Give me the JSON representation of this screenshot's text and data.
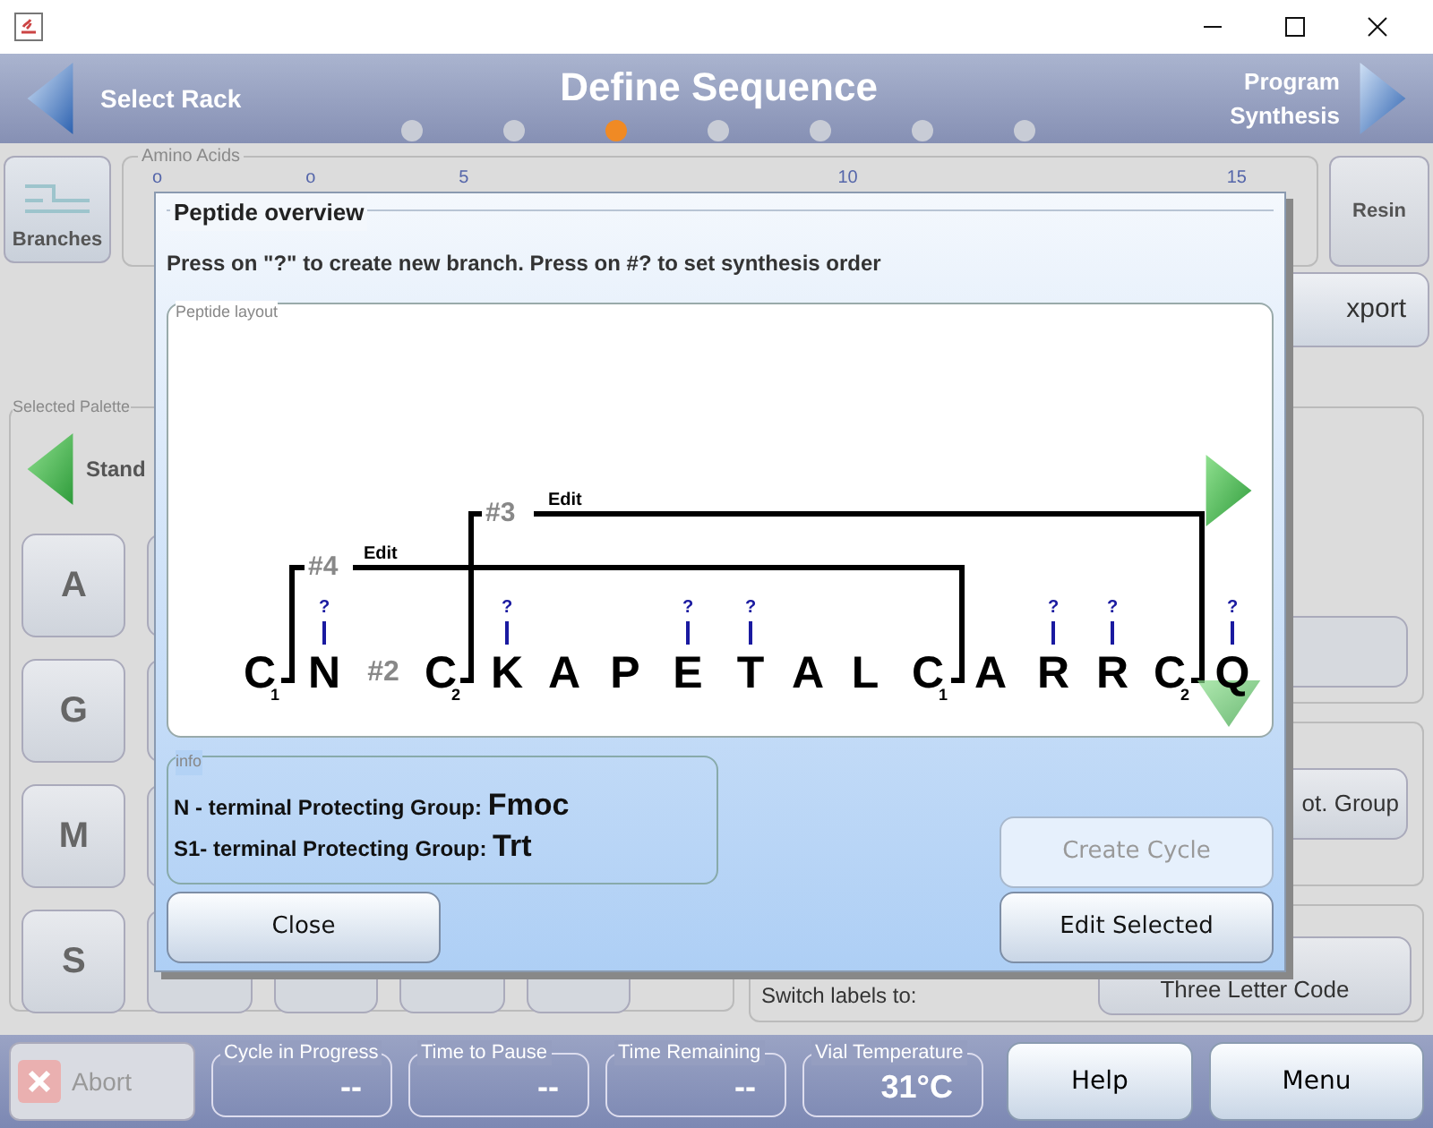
{
  "header": {
    "back_label": "Select Rack",
    "title": "Define Sequence",
    "next_label": "Program Synthesis",
    "steps": [
      {
        "selected": false
      },
      {
        "selected": false
      },
      {
        "selected": true
      },
      {
        "selected": false
      },
      {
        "selected": false
      },
      {
        "selected": false
      },
      {
        "selected": false
      }
    ]
  },
  "sequence_bar": {
    "branches_button": "Branches",
    "legend": "Amino Acids",
    "ticks": [
      "o",
      "o",
      "5",
      "10",
      "15"
    ],
    "resin_button": "Resin"
  },
  "export_button": "xport",
  "palette": {
    "legend": "Selected Palette",
    "name": "Stand",
    "keys": [
      "A",
      "G",
      "M",
      "S"
    ]
  },
  "options": {
    "group_button": "ot. Group",
    "switch_label": "Switch labels to:",
    "label_mode_button": "Three Letter Code"
  },
  "dialog": {
    "title": "Peptide overview",
    "instruction": "Press on \"?\" to create new branch. Press on #? to set synthesis order",
    "layout": {
      "legend": "Peptide layout",
      "residues": [
        {
          "kind": "residue",
          "text": "C",
          "sub": "1"
        },
        {
          "kind": "residue",
          "text": "N",
          "marker": "?"
        },
        {
          "kind": "order",
          "text": "#2"
        },
        {
          "kind": "residue",
          "text": "C",
          "sub": "2"
        },
        {
          "kind": "residue",
          "text": "K",
          "marker": "?"
        },
        {
          "kind": "residue",
          "text": "A"
        },
        {
          "kind": "residue",
          "text": "P"
        },
        {
          "kind": "residue",
          "text": "E",
          "marker": "?"
        },
        {
          "kind": "residue",
          "text": "T",
          "marker": "?"
        },
        {
          "kind": "residue",
          "text": "A"
        },
        {
          "kind": "residue",
          "text": "L"
        },
        {
          "kind": "residue",
          "text": "C",
          "sub": "1"
        },
        {
          "kind": "residue",
          "text": "A"
        },
        {
          "kind": "residue",
          "text": "R",
          "marker": "?"
        },
        {
          "kind": "residue",
          "text": "R",
          "marker": "?"
        },
        {
          "kind": "residue",
          "text": "C",
          "sub": "2"
        },
        {
          "kind": "residue",
          "text": "Q",
          "marker": "?"
        }
      ],
      "branches": [
        {
          "label": "#4",
          "edit": "Edit"
        },
        {
          "label": "#3",
          "edit": "Edit"
        }
      ]
    },
    "info": {
      "legend": "info",
      "lines": [
        {
          "label": "N - terminal Protecting Group:",
          "value": "Fmoc"
        },
        {
          "label": "S1- terminal Protecting Group:",
          "value": "Trt"
        }
      ]
    },
    "buttons": [
      {
        "label": "Close",
        "disabled": false
      },
      {
        "label": "Create Cycle",
        "disabled": true
      },
      {
        "label": "Edit Selected",
        "disabled": false
      }
    ]
  },
  "status_bar": {
    "abort": {
      "label": "Abort",
      "disabled": true
    },
    "fields": [
      {
        "label": "Cycle in Progress",
        "value": "--"
      },
      {
        "label": "Time to Pause",
        "value": "--"
      },
      {
        "label": "Time Remaining",
        "value": "--"
      },
      {
        "label": "Vial Temperature",
        "value": "31°C"
      }
    ],
    "help": "Help",
    "menu": "Menu"
  }
}
